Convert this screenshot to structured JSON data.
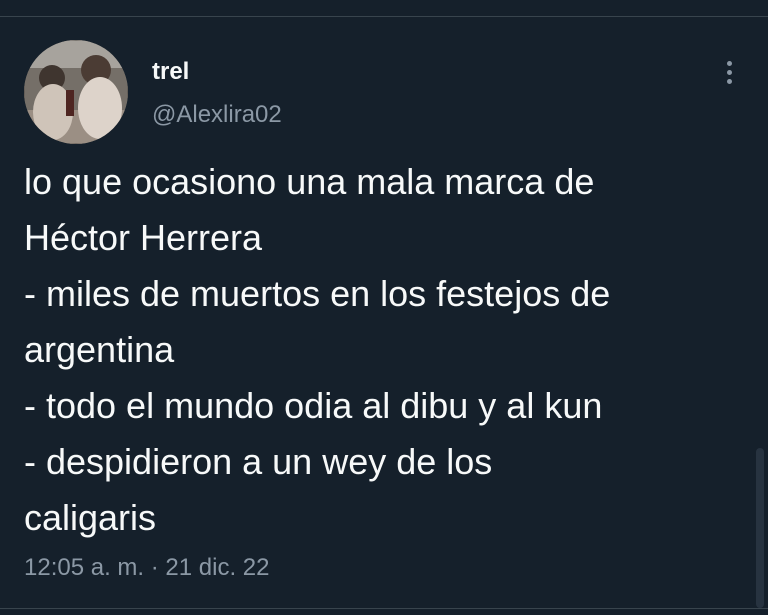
{
  "author": {
    "display_name": "trel",
    "handle": "@Alexlira02"
  },
  "tweet": {
    "lines": [
      "lo que ocasiono una mala marca de",
      "Héctor Herrera",
      "- miles de muertos en los festejos de",
      "argentina",
      "- todo el mundo odia al dibu y al kun",
      "- despidieron a un wey de los",
      "caligaris"
    ],
    "time": "12:05 a. m.",
    "separator": "·",
    "date": "21 dic. 22"
  },
  "icons": {
    "more": "more-vertical-icon"
  },
  "colors": {
    "background": "#15202b",
    "primary_text": "#f7f9f9",
    "secondary_text": "#8b98a5",
    "divider": "#38444d"
  }
}
